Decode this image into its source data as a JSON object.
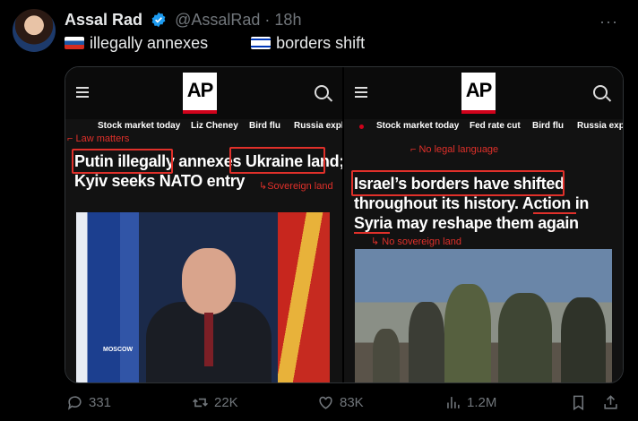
{
  "tweet": {
    "author_name": "Assal Rad",
    "handle": "@AssalRad",
    "dot": "·",
    "time": "18h",
    "more": "···",
    "text_part1": "illegally annexes",
    "text_part2": "borders shift"
  },
  "left": {
    "logo": "AP",
    "nav": [
      "Stock market today",
      "Liz Cheney",
      "Bird flu",
      "Russia expl"
    ],
    "anno_law": "Law matters",
    "headline1_a": "Putin illegally",
    "headline1_b": "annexes",
    "headline1_c": "Ukraine land;",
    "headline2": "Kyiv seeks NATO entry",
    "anno_sovereign": "Sovereign land",
    "photo_caption": "MOSCOW"
  },
  "right": {
    "logo": "AP",
    "nav": [
      "Stock market today",
      "Fed rate cut",
      "Bird flu",
      "Russia exp"
    ],
    "anno_nolegal": "No legal language",
    "headline1": "Israel’s borders have shifted",
    "headline2_a": "throughout its history.",
    "headline2_b": "Action in",
    "headline3_a": "Syria",
    "headline3_b": "may reshape them again",
    "anno_nosovereign": "No sovereign land"
  },
  "actions": {
    "replies": "331",
    "reposts": "22K",
    "likes": "83K",
    "views": "1.2M"
  },
  "colors": {
    "annotation_red": "#e0302a",
    "ap_red": "#d0021b",
    "verified_blue": "#1d9bf0"
  }
}
